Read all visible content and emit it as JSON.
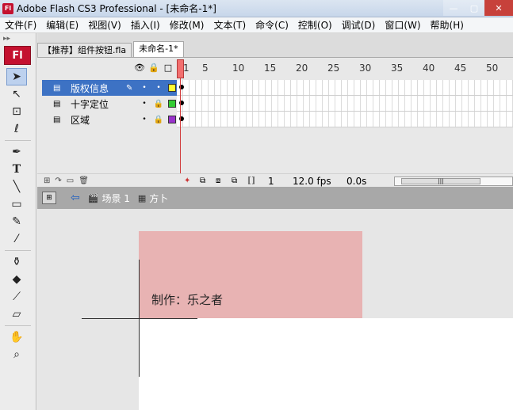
{
  "window": {
    "app_icon": "Fl",
    "title": "Adobe Flash CS3 Professional - [未命名-1*]"
  },
  "menu": [
    "文件(F)",
    "编辑(E)",
    "视图(V)",
    "插入(I)",
    "修改(M)",
    "文本(T)",
    "命令(C)",
    "控制(O)",
    "调试(D)",
    "窗口(W)",
    "帮助(H)"
  ],
  "tools_panel": {
    "logo": "Fl",
    "tools": [
      {
        "name": "selection-tool",
        "glyph": "➤",
        "selected": true
      },
      {
        "name": "subselection-tool",
        "glyph": "↖"
      },
      {
        "name": "free-transform-tool",
        "glyph": "⊡"
      },
      {
        "name": "lasso-tool",
        "glyph": "ℓ"
      },
      {
        "name": "pen-tool",
        "glyph": "✒"
      },
      {
        "name": "text-tool",
        "glyph": "T"
      },
      {
        "name": "line-tool",
        "glyph": "╲"
      },
      {
        "name": "rectangle-tool",
        "glyph": "▭"
      },
      {
        "name": "pencil-tool",
        "glyph": "✎"
      },
      {
        "name": "brush-tool",
        "glyph": "🖌"
      },
      {
        "name": "ink-bottle-tool",
        "glyph": "⚱"
      },
      {
        "name": "paint-bucket-tool",
        "glyph": "◆"
      },
      {
        "name": "eyedropper-tool",
        "glyph": "💧"
      },
      {
        "name": "eraser-tool",
        "glyph": "⌫"
      },
      {
        "name": "hand-tool",
        "glyph": "✋"
      },
      {
        "name": "zoom-tool",
        "glyph": "🔍"
      }
    ]
  },
  "doc_tabs": [
    {
      "label": "【推荐】组件按钮.fla",
      "active": false
    },
    {
      "label": "未命名-1*",
      "active": true
    }
  ],
  "timeline": {
    "ruler": [
      "1",
      "5",
      "10",
      "15",
      "20",
      "25",
      "30",
      "35",
      "40",
      "45",
      "50"
    ],
    "layers": [
      {
        "name": "版权信息",
        "selected": true,
        "color": "#ffff33"
      },
      {
        "name": "十字定位",
        "selected": false,
        "color": "#33cc33"
      },
      {
        "name": "区域",
        "selected": false,
        "color": "#9933cc"
      }
    ],
    "current_frame": "1",
    "fps": "12.0 fps",
    "time": "0.0s"
  },
  "editbar": {
    "scene": "场景 1",
    "symbol": "方卜"
  },
  "stage": {
    "credit_text": "制作：乐之者",
    "box_color": "#e8b3b3"
  }
}
